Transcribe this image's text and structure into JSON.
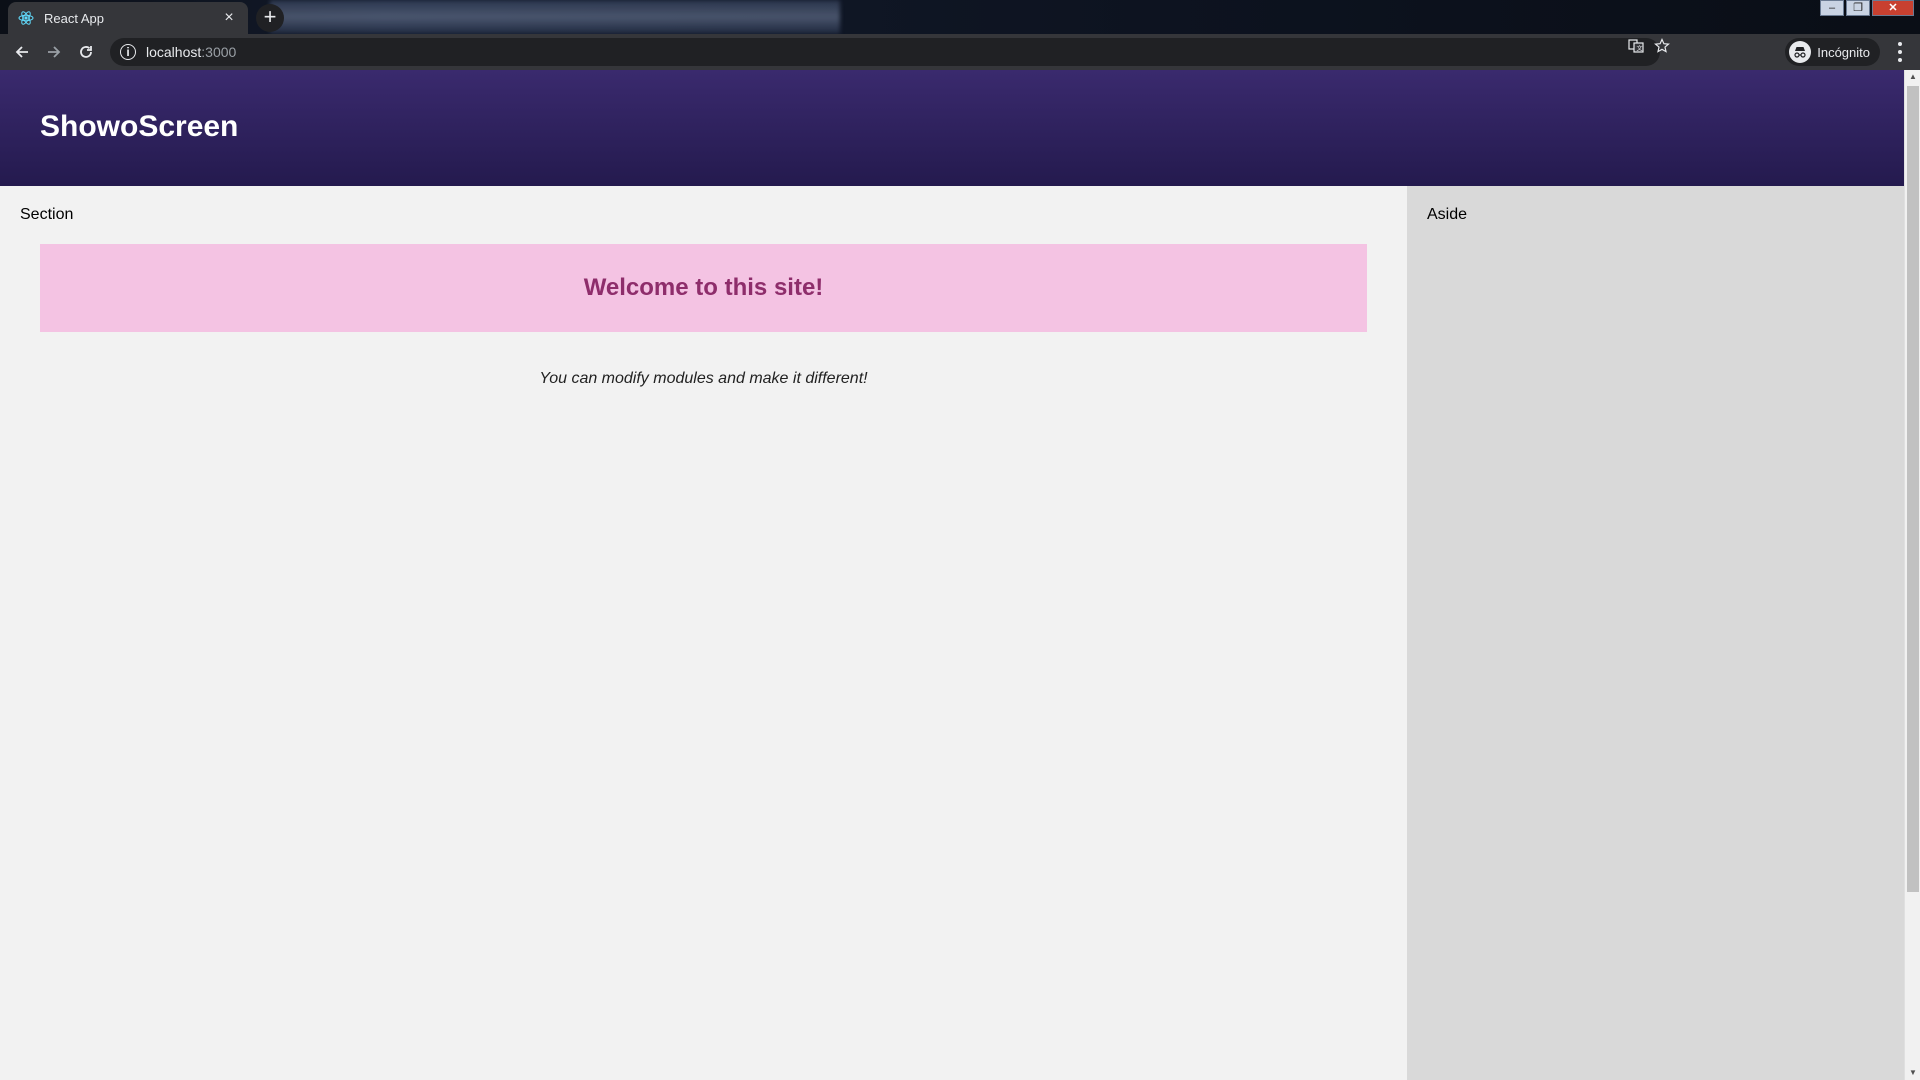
{
  "browser": {
    "tab_title": "React App",
    "tab_close": "×",
    "new_tab": "+",
    "url_host": "localhost",
    "url_port": ":3000",
    "profile_label": "Incógnito",
    "icons": {
      "favicon": "react-logo-icon",
      "back": "arrow-left-icon",
      "forward": "arrow-right-icon",
      "reload": "reload-icon",
      "site_info": "info-icon",
      "translate": "translate-icon",
      "bookmark": "star-icon",
      "incognito": "incognito-icon",
      "menu": "three-dots-icon"
    }
  },
  "app": {
    "brand": "ShowoScreen",
    "section_label": "Section",
    "welcome_title": "Welcome to this site!",
    "tagline": "You can modify modules and make it different!",
    "aside_label": "Aside"
  },
  "colors": {
    "header_top": "#3a2a6e",
    "header_bottom": "#241a4e",
    "welcome_bg": "#f4c3e3",
    "welcome_text": "#8e2d6b",
    "section_bg": "#f2f2f2",
    "aside_bg": "#d9d9d9"
  }
}
